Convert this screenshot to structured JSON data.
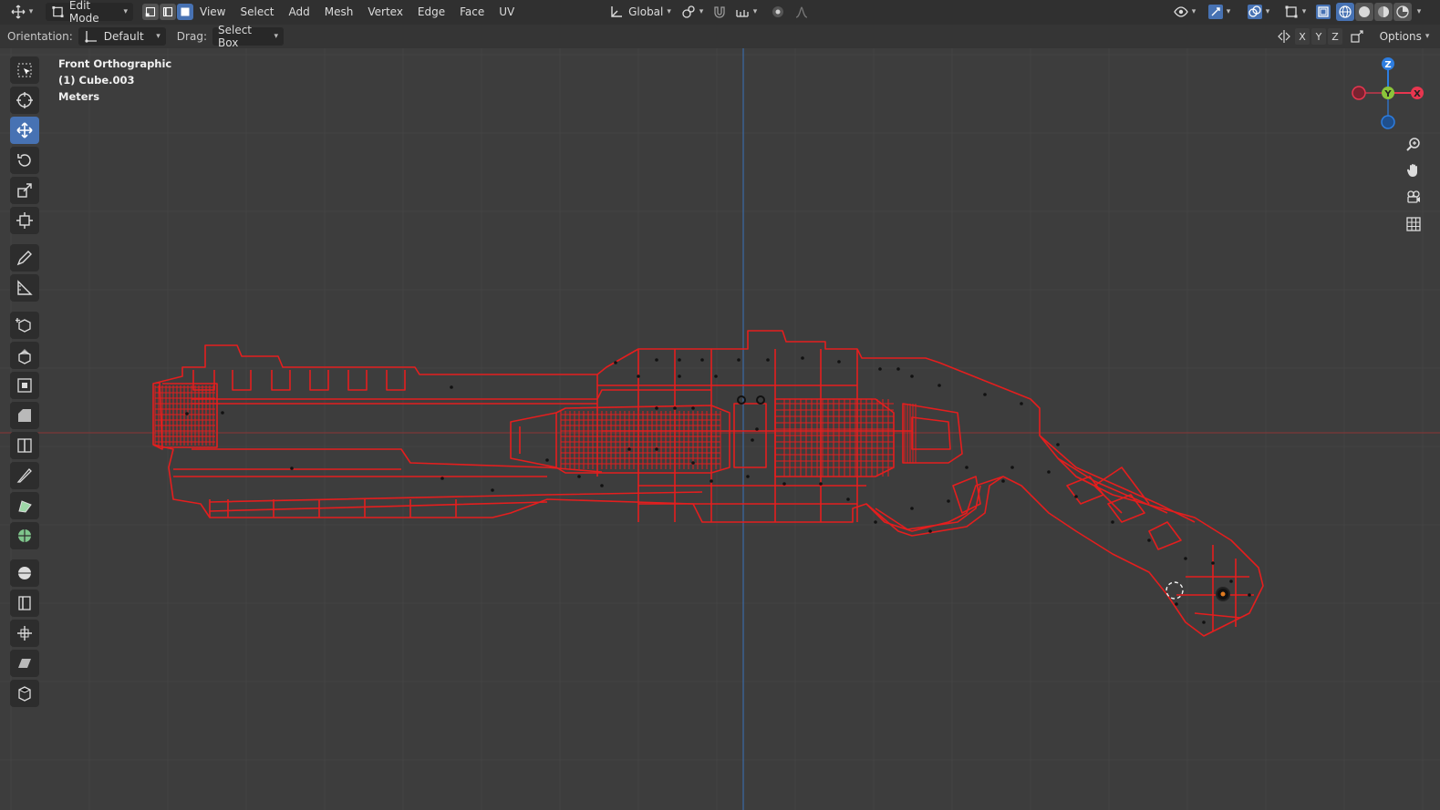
{
  "header": {
    "mode": "Edit Mode",
    "menus": [
      "View",
      "Select",
      "Add",
      "Mesh",
      "Vertex",
      "Edge",
      "Face",
      "UV"
    ],
    "transform_orientation": "Global"
  },
  "tool_options": {
    "orientation_label": "Orientation:",
    "orientation_value": "Default",
    "drag_label": "Drag:",
    "drag_value": "Select Box",
    "axes": [
      "X",
      "Y",
      "Z"
    ],
    "options_label": "Options"
  },
  "viewport": {
    "view_name": "Front Orthographic",
    "object_name": "(1) Cube.003",
    "units": "Meters",
    "gizmo_axes": {
      "z": "Z",
      "y": "Y",
      "x": "X"
    },
    "colors": {
      "x": "#e8364f",
      "y": "#8bc43a",
      "z": "#2d7de0",
      "mesh": "#e41e1e"
    }
  },
  "toolbar": {
    "tools": [
      "select-box",
      "cursor",
      "move",
      "rotate",
      "scale",
      "transform",
      "annotate",
      "measure",
      "add-cube",
      "extrude-region",
      "inset-faces",
      "bevel",
      "loop-cut",
      "knife",
      "poly-build",
      "spin",
      "smooth",
      "edge-slide",
      "shrink-fatten",
      "shear",
      "rip-region"
    ],
    "active": "move"
  }
}
